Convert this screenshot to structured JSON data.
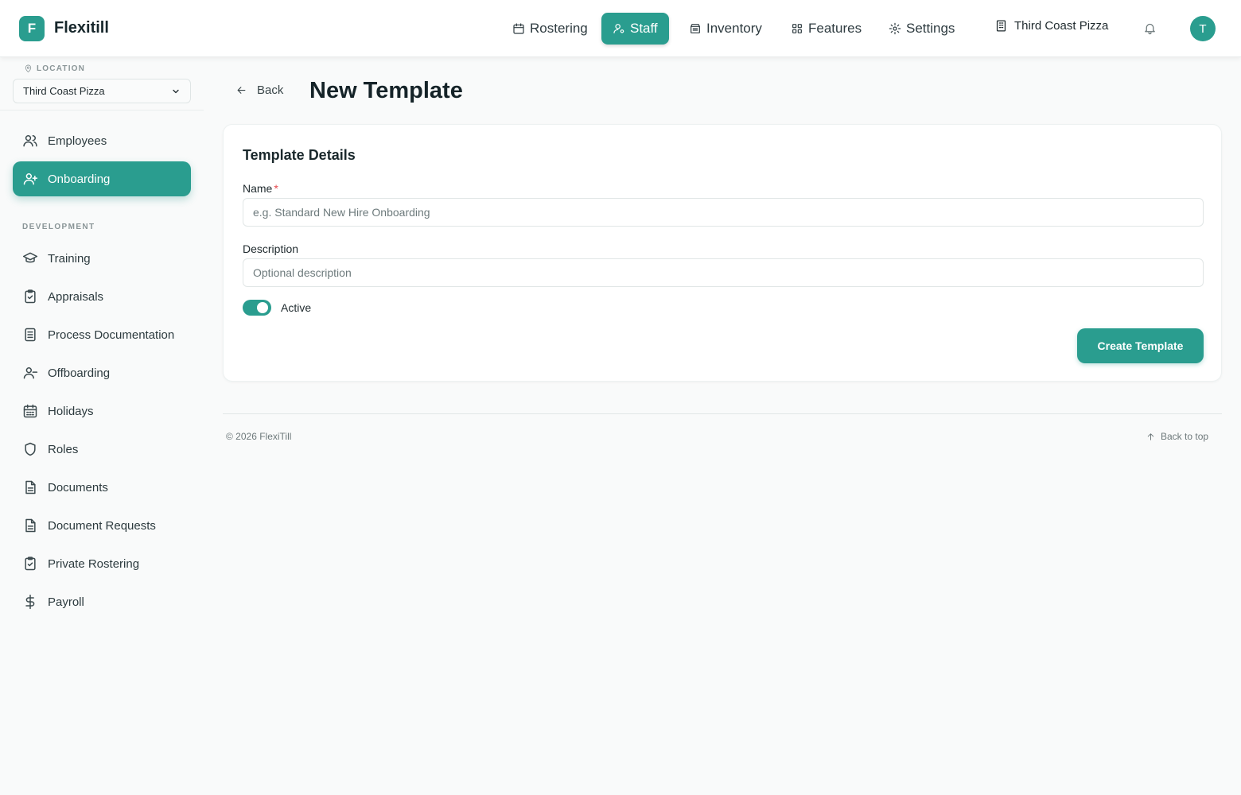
{
  "app": {
    "logo_letter": "F",
    "name": "Flexitill"
  },
  "topnav": [
    {
      "label": "Rostering",
      "icon": "calendar-icon"
    },
    {
      "label": "Staff",
      "icon": "user-cog-icon",
      "active": true
    },
    {
      "label": "Inventory",
      "icon": "archive-icon"
    },
    {
      "label": "Features",
      "icon": "grid-icon"
    },
    {
      "label": "Settings",
      "icon": "gear-icon"
    }
  ],
  "store": {
    "name": "Third Coast Pizza",
    "icon": "building-icon"
  },
  "user": {
    "initial": "T"
  },
  "sidebar": {
    "location_label": "LOCATION",
    "location_value": "Third Coast Pizza",
    "items": [
      {
        "label": "Employees",
        "icon": "users-icon"
      },
      {
        "label": "Onboarding",
        "icon": "user-plus-icon",
        "active": true
      }
    ],
    "section_label": "DEVELOPMENT",
    "dev_items": [
      {
        "label": "Training",
        "icon": "graduation-cap-icon"
      },
      {
        "label": "Appraisals",
        "icon": "clipboard-check-icon"
      },
      {
        "label": "Process Documentation",
        "icon": "document-text-icon"
      },
      {
        "label": "Offboarding",
        "icon": "user-minus-icon"
      },
      {
        "label": "Holidays",
        "icon": "calendar-days-icon"
      },
      {
        "label": "Roles",
        "icon": "shield-icon"
      },
      {
        "label": "Documents",
        "icon": "file-text-icon"
      },
      {
        "label": "Document Requests",
        "icon": "file-text-icon"
      },
      {
        "label": "Private Rostering",
        "icon": "clipboard-check-icon"
      },
      {
        "label": "Payroll",
        "icon": "dollar-icon"
      }
    ]
  },
  "page": {
    "back_label": "Back",
    "title": "New Template",
    "card_title": "Template Details",
    "name_label": "Name",
    "name_required": "*",
    "name_placeholder": "e.g. Standard New Hire Onboarding",
    "description_label": "Description",
    "description_placeholder": "Optional description",
    "active_label": "Active",
    "active_on": true,
    "create_button": "Create Template"
  },
  "footer": {
    "copyright": "© 2026 FlexiTill",
    "back_to_top": "Back to top"
  },
  "colors": {
    "accent": "#2a9d8f",
    "required": "#e5484d"
  }
}
